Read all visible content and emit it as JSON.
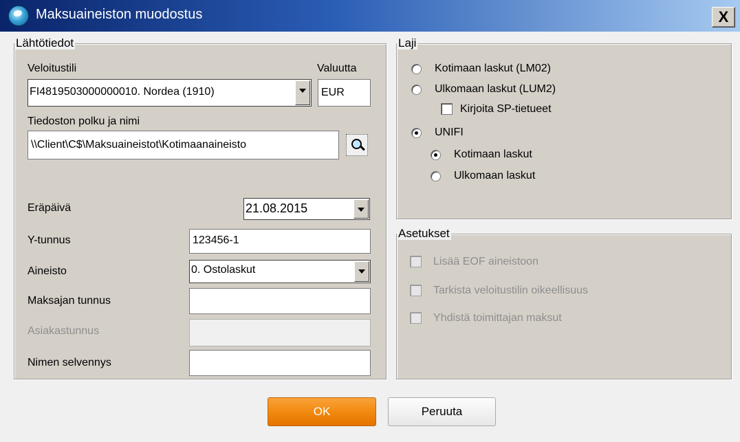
{
  "window": {
    "title": "Maksuaineiston muodostus",
    "close_label": "X"
  },
  "lahtotiedot": {
    "title": "Lähtötiedot",
    "veloitustili_label": "Veloitustili",
    "veloitustili_value": "FI4819503000000010. Nordea (1910)",
    "valuutta_label": "Valuutta",
    "valuutta_value": "EUR",
    "path_label": "Tiedoston polku ja nimi",
    "path_value": "\\\\Client\\C$\\Maksuaineistot\\Kotimaanaineisto",
    "erapaiva_label": "Eräpäivä",
    "erapaiva_value": "21.08.2015",
    "ytunnus_label": "Y-tunnus",
    "ytunnus_value": "123456-1",
    "aineisto_label": "Aineisto",
    "aineisto_value": "0. Ostolaskut",
    "maksajan_label": "Maksajan tunnus",
    "maksajan_value": "",
    "asiakas_label": "Asiakastunnus",
    "asiakas_value": "",
    "nimen_label": "Nimen selvennys",
    "nimen_value": ""
  },
  "laji": {
    "title": "Laji",
    "kotimaan_lm02": "Kotimaan laskut (LM02)",
    "ulkomaan_lum2": "Ulkomaan laskut (LUM2)",
    "kirjoita_sp": "Kirjoita SP-tietueet",
    "unifi": "UNIFI",
    "unifi_kotimaan": "Kotimaan laskut",
    "unifi_ulkomaan": "Ulkomaan laskut"
  },
  "asetukset": {
    "title": "Asetukset",
    "eof": "Lisää EOF aineistoon",
    "tarkista": "Tarkista veloitustilin oikeellisuus",
    "yhdista": "Yhdistä toimittajan maksut"
  },
  "buttons": {
    "ok": "OK",
    "cancel": "Peruuta"
  }
}
